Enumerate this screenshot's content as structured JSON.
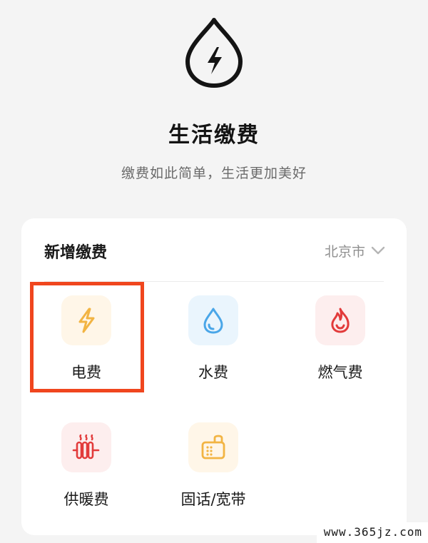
{
  "header": {
    "icon": "lightning-drop-icon",
    "title": "生活缴费",
    "subtitle": "缴费如此简单，生活更加美好"
  },
  "card": {
    "title": "新增缴费",
    "city": "北京市",
    "items": [
      {
        "label": "电费",
        "icon": "lightning-icon",
        "color": "#f2b443",
        "bg": "#fff6e8"
      },
      {
        "label": "水费",
        "icon": "water-drop-icon",
        "color": "#4aa6e8",
        "bg": "#eaf5fd"
      },
      {
        "label": "燃气费",
        "icon": "flame-icon",
        "color": "#e23b3b",
        "bg": "#fdeeee"
      },
      {
        "label": "供暖费",
        "icon": "radiator-icon",
        "color": "#e23b3b",
        "bg": "#fdeeee"
      },
      {
        "label": "固话/宽带",
        "icon": "landline-phone-icon",
        "color": "#f2b443",
        "bg": "#fff6e8"
      }
    ],
    "highlight_color": "#f0461e"
  },
  "watermark": "www.365jz.com"
}
